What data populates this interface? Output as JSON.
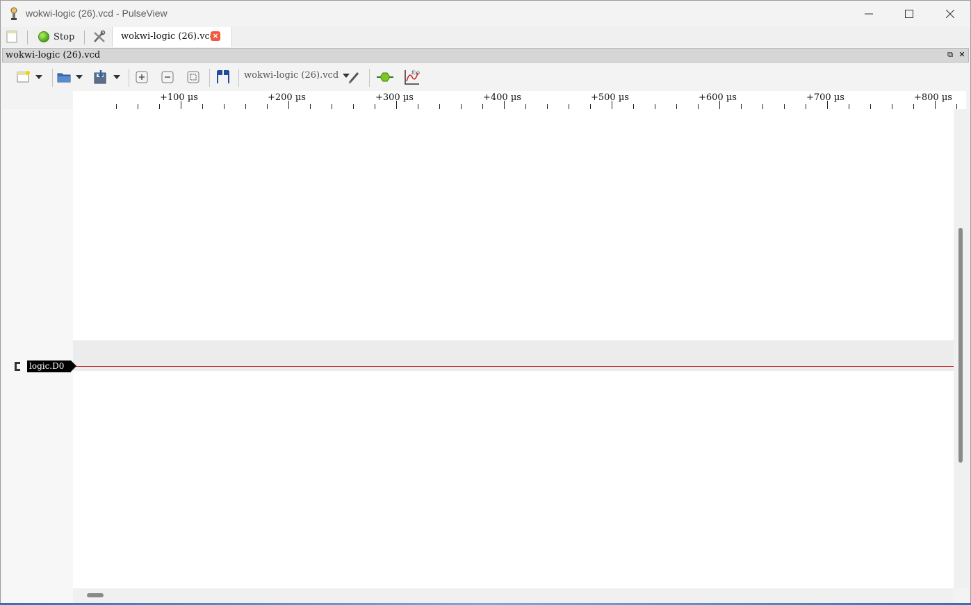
{
  "window": {
    "title": "wokwi-logic (26).vcd - PulseView"
  },
  "main_toolbar": {
    "stop_label": "Stop"
  },
  "tabs": [
    {
      "label": "wokwi-logic (26).vcd",
      "active": true
    }
  ],
  "session": {
    "title": "wokwi-logic (26).vcd",
    "device_select": "wokwi-logic (26).vcd"
  },
  "ruler": {
    "ticks": [
      "+100 µs",
      "+200 µs",
      "+300 µs",
      "+400 µs",
      "+500 µs",
      "+600 µs",
      "+700 µs",
      "+800 µs"
    ]
  },
  "channels": [
    {
      "name": "logic.D0",
      "color": "#c81e1e"
    }
  ],
  "icons": {
    "app": "pulseview-icon",
    "minimize": "minimize-icon",
    "maximize": "maximize-icon",
    "close": "close-icon",
    "new_session": "new-session-icon",
    "settings": "settings-icon",
    "open": "open-folder-icon",
    "save": "save-icon",
    "zoom_in": "zoom-in-icon",
    "zoom_out": "zoom-out-icon",
    "zoom_fit": "zoom-fit-icon",
    "cursor": "cursor-pair-icon",
    "config": "probe-icon",
    "decoder": "decoder-icon",
    "math": "math-signal-icon"
  }
}
